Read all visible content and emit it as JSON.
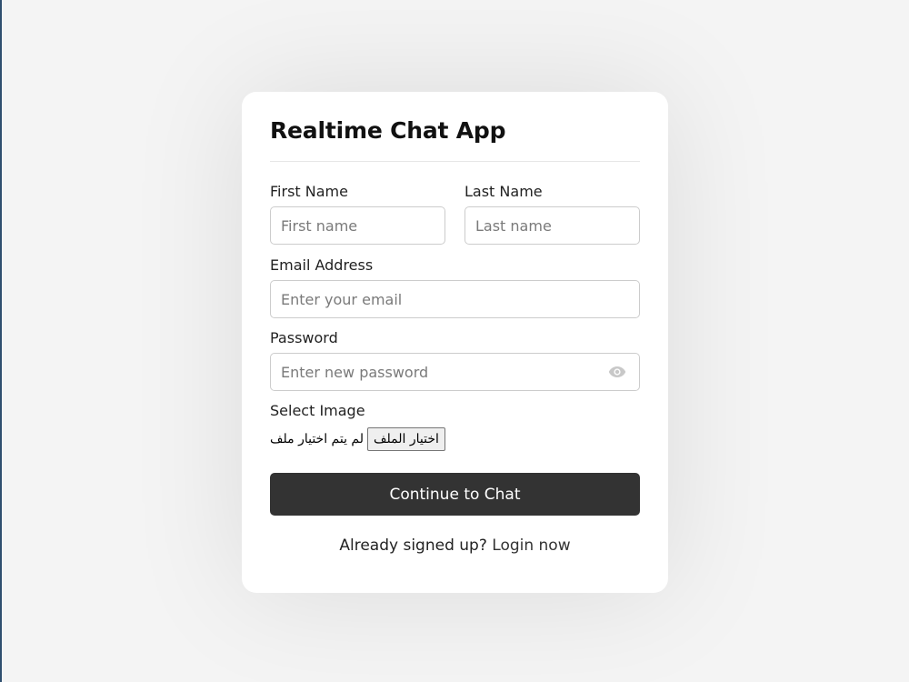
{
  "form": {
    "title": "Realtime Chat App",
    "first_name": {
      "label": "First Name",
      "placeholder": "First name"
    },
    "last_name": {
      "label": "Last Name",
      "placeholder": "Last name"
    },
    "email": {
      "label": "Email Address",
      "placeholder": "Enter your email"
    },
    "password": {
      "label": "Password",
      "placeholder": "Enter new password",
      "toggle_icon": "eye-icon"
    },
    "image": {
      "label": "Select Image",
      "button_label": "اختيار الملف",
      "status": "لم يتم اختيار ملف"
    },
    "submit_label": "Continue to Chat",
    "footer_text": "Already signed up?",
    "footer_link": "Login now"
  },
  "colors": {
    "background": "#f4f4f4",
    "card": "#ffffff",
    "button": "#333333",
    "border": "#cccccc"
  }
}
